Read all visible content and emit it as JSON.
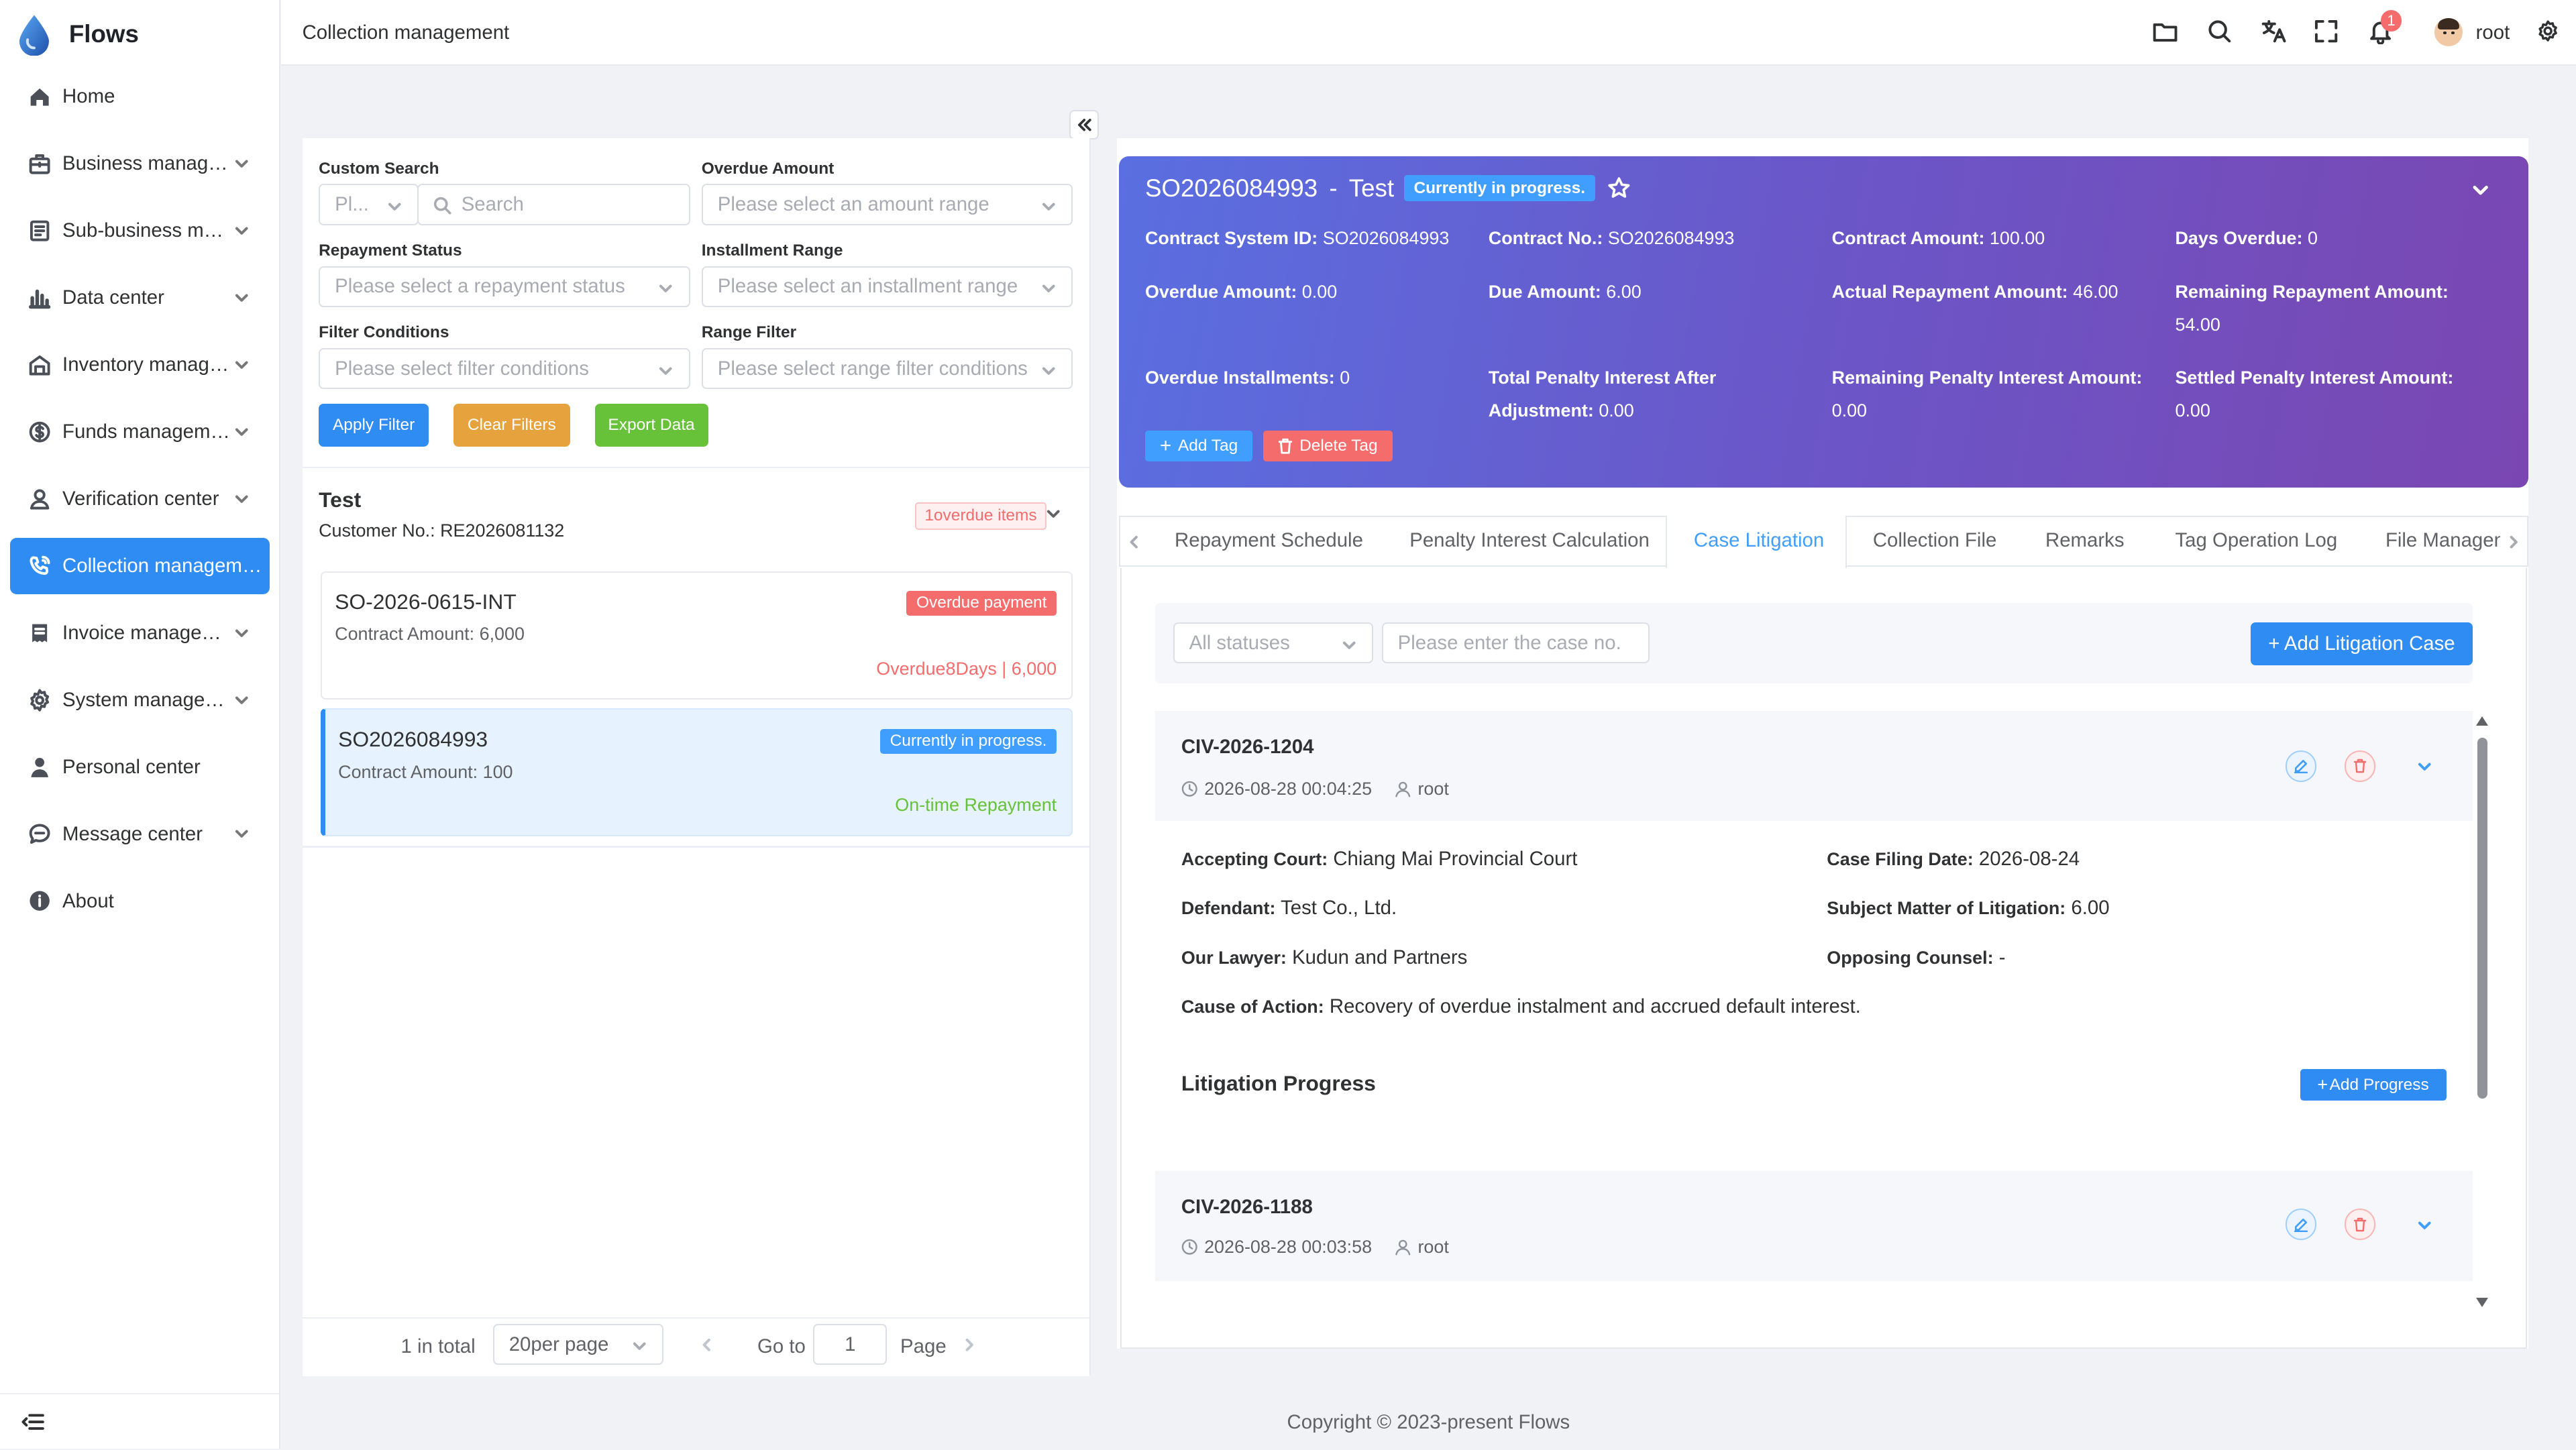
{
  "app": {
    "name": "Flows"
  },
  "sidebar": {
    "items": [
      {
        "label": "Home",
        "icon": "home-icon",
        "expandable": false
      },
      {
        "label": "Business manag…",
        "icon": "briefcase-icon",
        "expandable": true
      },
      {
        "label": "Sub-business m…",
        "icon": "document-icon",
        "expandable": true
      },
      {
        "label": "Data center",
        "icon": "bar-chart-icon",
        "expandable": true
      },
      {
        "label": "Inventory manag…",
        "icon": "warehouse-icon",
        "expandable": true
      },
      {
        "label": "Funds managem…",
        "icon": "coin-icon",
        "expandable": true
      },
      {
        "label": "Verification center",
        "icon": "user-check-icon",
        "expandable": true
      },
      {
        "label": "Collection managem…",
        "icon": "phone-icon",
        "expandable": false,
        "active": true
      },
      {
        "label": "Invoice manage…",
        "icon": "invoice-icon",
        "expandable": true
      },
      {
        "label": "System manage…",
        "icon": "gear-icon",
        "expandable": true
      },
      {
        "label": "Personal center",
        "icon": "person-icon",
        "expandable": false
      },
      {
        "label": "Message center",
        "icon": "chat-icon",
        "expandable": true
      },
      {
        "label": "About",
        "icon": "info-icon",
        "expandable": false
      }
    ]
  },
  "header": {
    "breadcrumb": "Collection management",
    "notification_count": "1",
    "user": "root"
  },
  "filters": {
    "custom_search_label": "Custom Search",
    "custom_search_prefix": "Pl...",
    "search_placeholder": "Search",
    "overdue_amount_label": "Overdue Amount",
    "overdue_amount_placeholder": "Please select an amount range",
    "repayment_status_label": "Repayment Status",
    "repayment_status_placeholder": "Please select a repayment status",
    "installment_range_label": "Installment Range",
    "installment_range_placeholder": "Please select an installment range",
    "filter_conditions_label": "Filter Conditions",
    "filter_conditions_placeholder": "Please select filter conditions",
    "range_filter_label": "Range Filter",
    "range_filter_placeholder": "Please select range filter conditions",
    "apply": "Apply Filter",
    "clear": "Clear Filters",
    "export": "Export Data"
  },
  "customer": {
    "name": "Test",
    "customer_no": "Customer No.: RE2026081132",
    "overdue_badge": "1overdue items"
  },
  "orders": [
    {
      "id": "SO-2026-0615-INT",
      "amount": "Contract Amount: 6,000",
      "status": "Overdue payment",
      "status_color": "#f56c6c",
      "note": "Overdue8Days | 6,000",
      "note_color": "#f56c6c"
    },
    {
      "id": "SO2026084993",
      "amount": "Contract Amount: 100",
      "status": "Currently in progress.",
      "status_color": "#409eff",
      "note": "On-time Repayment",
      "note_color": "#67c23a"
    }
  ],
  "pagination": {
    "total": "1 in total",
    "page_size": "20per page",
    "goto_label": "Go to",
    "page_value": "1",
    "page_suffix": "Page"
  },
  "detail": {
    "order_no": "SO2026084993",
    "separator": "-",
    "customer": "Test",
    "status": "Currently in progress.",
    "fields": [
      {
        "label": "Contract System ID:",
        "value": "SO2026084993"
      },
      {
        "label": "Contract No.:",
        "value": "SO2026084993"
      },
      {
        "label": "Contract Amount:",
        "value": "100.00"
      },
      {
        "label": "Days Overdue:",
        "value": "0"
      },
      {
        "label": "Overdue Amount:",
        "value": "0.00"
      },
      {
        "label": "Due Amount:",
        "value": "6.00"
      },
      {
        "label": "Actual Repayment Amount:",
        "value": "46.00"
      },
      {
        "label": "Remaining Repayment Amount:",
        "value": "54.00"
      },
      {
        "label": "Overdue Installments:",
        "value": "0"
      },
      {
        "label": "Total Penalty Interest After Adjustment:",
        "value": "0.00"
      },
      {
        "label": "Remaining Penalty Interest Amount:",
        "value": "0.00"
      },
      {
        "label": "Settled Penalty Interest Amount:",
        "value": "0.00"
      }
    ],
    "add_tag": "Add Tag",
    "delete_tag": "Delete Tag"
  },
  "tabs": [
    "Repayment Schedule",
    "Penalty Interest Calculation",
    "Case Litigation",
    "Collection File",
    "Remarks",
    "Tag Operation Log",
    "File Managen"
  ],
  "litigation": {
    "status_placeholder": "All statuses",
    "case_no_placeholder": "Please enter the case no.",
    "add_case": "+ Add Litigation Case",
    "cases": [
      {
        "case_no": "CIV-2026-1204",
        "date": "2026-08-28 00:04:25",
        "user": "root",
        "court_label": "Accepting Court:",
        "court": "Chiang Mai Provincial Court",
        "filing_label": "Case Filing Date:",
        "filing": "2026-08-24",
        "defendant_label": "Defendant:",
        "defendant": "Test Co., Ltd.",
        "subject_label": "Subject Matter of Litigation:",
        "subject": "6.00",
        "lawyer_label": "Our Lawyer:",
        "lawyer": "Kudun and Partners",
        "opposing_label": "Opposing Counsel:",
        "opposing": "-",
        "cause_label": "Cause of Action:",
        "cause": "Recovery of overdue instalment and accrued default interest.",
        "progress_title": "Litigation Progress",
        "add_progress": "Add Progress"
      },
      {
        "case_no": "CIV-2026-1188",
        "date": "2026-08-28 00:03:58",
        "user": "root"
      }
    ]
  },
  "footer": {
    "copyright": "Copyright © 2023-present Flows"
  },
  "colors": {
    "primary": "#2f8cf3",
    "danger": "#f56c6c",
    "warning": "#e6a23c",
    "success": "#67c23a"
  }
}
